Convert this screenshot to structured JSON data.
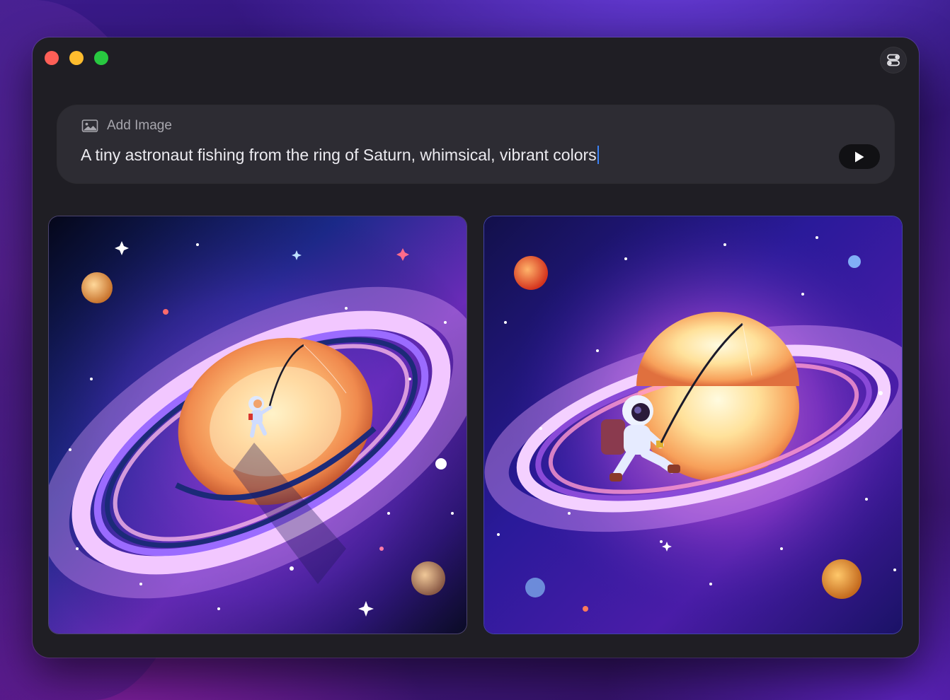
{
  "window": {
    "controls": [
      "close",
      "minimize",
      "zoom"
    ],
    "settings_icon": "toggle-settings-icon"
  },
  "prompt": {
    "add_image_label": "Add Image",
    "add_image_icon": "image-icon",
    "text": "A tiny astronaut fishing from the ring of Saturn, whimsical, vibrant colors",
    "send_icon": "play-icon"
  },
  "results": {
    "images": [
      {
        "subject": "astronaut fishing on Saturn ring"
      },
      {
        "subject": "astronaut fishing on Saturn ring"
      }
    ]
  },
  "colors": {
    "window_bg": "#1f1e24",
    "card_bg": "#2d2c33",
    "caret": "#3b82f6",
    "close": "#fe5f57",
    "minimize": "#febc2e",
    "zoom": "#28c840"
  }
}
